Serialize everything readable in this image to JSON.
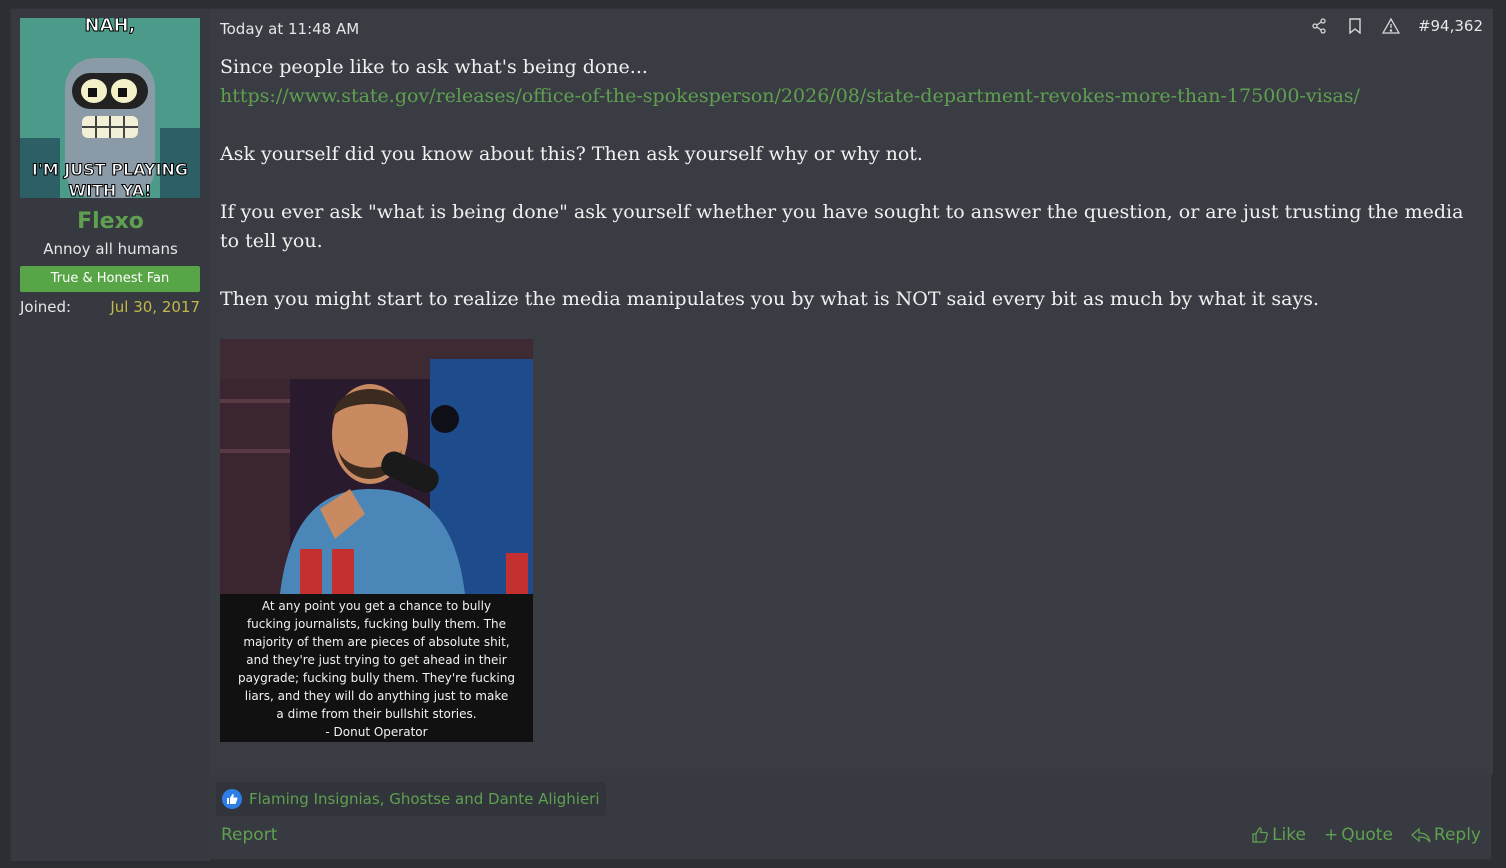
{
  "user": {
    "avatar_top_text": "NAH,",
    "avatar_bottom_text": "I'M JUST PLAYING WITH YA!",
    "name": "Flexo",
    "title": "Annoy all humans",
    "banner": "True & Honest Fan",
    "joined_label": "Joined:",
    "joined_value": "Jul 30, 2017"
  },
  "post": {
    "timestamp": "Today at 11:48 AM",
    "post_number": "#94,362",
    "line1": "Since people like to ask what's being done...",
    "link": "https://www.state.gov/releases/office-of-the-spokesperson/2026/08/state-department-revokes-more-than-175000-visas/",
    "para2": "Ask yourself did you know about this? Then ask yourself why or why not.",
    "para3": "If you ever ask \"what is being done\" ask yourself whether you have sought to answer the question, or are just trusting the media to tell you.",
    "para4": "Then you might start to realize the media manipulates you by what is NOT said every bit as much by what it says.",
    "image_caption": [
      "At any point you get a chance to bully",
      "fucking journalists, fucking bully them. The",
      "majority of them are pieces of absolute shit,",
      "and they're just trying to get ahead in their",
      "paygrade; fucking bully them. They're fucking",
      "liars, and they will do anything just to make",
      "a dime from their bullshit stories.",
      "- Donut Operator"
    ]
  },
  "footer": {
    "reactions": "Flaming Insignias, Ghostse and Dante Alighieri",
    "report": "Report",
    "like": "Like",
    "quote": "Quote",
    "reply": "Reply"
  },
  "colors": {
    "accent_green": "#5fa050",
    "banner_green": "#58a548",
    "date_yellow": "#c5b84a",
    "like_blue": "#2d7ee6"
  }
}
